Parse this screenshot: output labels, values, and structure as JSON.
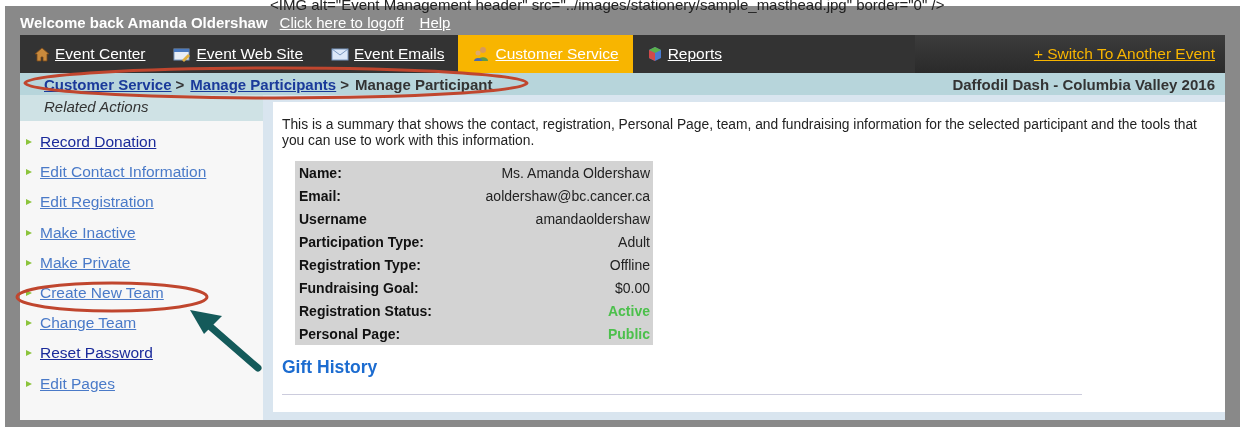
{
  "source_line": "<IMG alt=\"Event Management header\" src=\"../images/stationery/sample_masthead.jpg\" border=\"0\" />",
  "welcome": "Welcome back Amanda Oldershaw",
  "header_links": [
    "Click here to logoff",
    "Help"
  ],
  "tabs": [
    {
      "label": "Event Center",
      "selected": false
    },
    {
      "label": "Event Web Site",
      "selected": false
    },
    {
      "label": "Event Emails",
      "selected": false
    },
    {
      "label": "Customer Service",
      "selected": true
    },
    {
      "label": "Reports",
      "selected": false
    }
  ],
  "switch_event": "+ Switch To Another Event",
  "breadcrumb": [
    {
      "label": "Customer Service",
      "kind": "link"
    },
    {
      "label": ">",
      "kind": "separator"
    },
    {
      "label": "Manage Participants",
      "kind": "link"
    },
    {
      "label": ">",
      "kind": "separator"
    },
    {
      "label": "Manage Participant",
      "kind": "current"
    }
  ],
  "event_name": "Daffodil Dash - Columbia Valley 2016",
  "sidebar": {
    "title": "Related Actions",
    "items": [
      {
        "label": "Record Donation",
        "visited": false
      },
      {
        "label": "Edit Contact Information",
        "visited": true
      },
      {
        "label": "Edit Registration",
        "visited": true
      },
      {
        "label": "Make Inactive",
        "visited": true
      },
      {
        "label": "Make Private",
        "visited": true
      },
      {
        "label": "Create New Team",
        "visited": true
      },
      {
        "label": "Change Team",
        "visited": true
      },
      {
        "label": "Reset Password",
        "visited": false
      },
      {
        "label": "Edit Pages",
        "visited": true
      }
    ]
  },
  "intro": "This is a summary that shows the contact, registration, Personal Page, team, and fundraising information for the selected participant and the tools that you can use to work with this information.",
  "summary": [
    {
      "label": "Name:",
      "value": "Ms. Amanda Oldershaw",
      "highlight": false
    },
    {
      "label": "Email:",
      "value": "aoldershaw@bc.cancer.ca",
      "highlight": false
    },
    {
      "label": "Username",
      "value": "amandaoldershaw",
      "highlight": false
    },
    {
      "label": "Participation Type:",
      "value": "Adult",
      "highlight": false
    },
    {
      "label": "Registration Type:",
      "value": "Offline",
      "highlight": false
    },
    {
      "label": "Fundraising Goal:",
      "value": "$0.00",
      "highlight": false
    },
    {
      "label": "Registration Status:",
      "value": "Active",
      "highlight": true
    },
    {
      "label": "Personal Page:",
      "value": "Public",
      "highlight": true
    }
  ],
  "section_heading": "Gift History"
}
